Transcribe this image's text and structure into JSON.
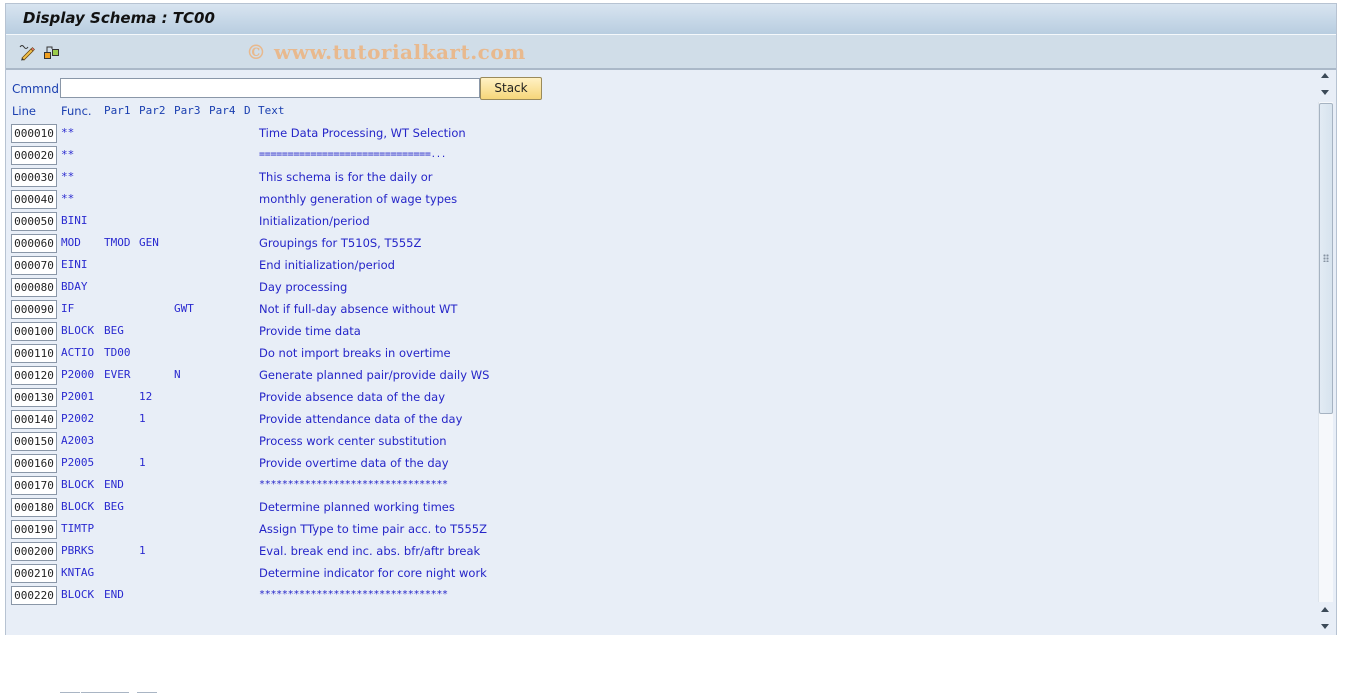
{
  "window": {
    "title": "Display Schema : TC00",
    "watermark": "© www.tutorialkart.com"
  },
  "toolbar": {
    "icons": [
      "display-change-icon",
      "other-object-icon"
    ]
  },
  "command": {
    "label": "Cmmnd",
    "value": "",
    "placeholder": "",
    "stack_button": "Stack"
  },
  "columns": {
    "line": "Line",
    "func": "Func.",
    "par1": "Par1",
    "par2": "Par2",
    "par3": "Par3",
    "par4": "Par4",
    "d": "D",
    "text": "Text"
  },
  "rows": [
    {
      "line": "000010",
      "func": "**",
      "par1": "",
      "par2": "",
      "par3": "",
      "par4": "",
      "d": "",
      "text": "Time Data Processing, WT Selection"
    },
    {
      "line": "000020",
      "func": "**",
      "par1": "",
      "par2": "",
      "par3": "",
      "par4": "",
      "d": "",
      "text": "==============================",
      "truncated": "..."
    },
    {
      "line": "000030",
      "func": "**",
      "par1": "",
      "par2": "",
      "par3": "",
      "par4": "",
      "d": "",
      "text": "This schema is for the daily or"
    },
    {
      "line": "000040",
      "func": "**",
      "par1": "",
      "par2": "",
      "par3": "",
      "par4": "",
      "d": "",
      "text": "monthly generation of wage types"
    },
    {
      "line": "000050",
      "func": "BINI",
      "par1": "",
      "par2": "",
      "par3": "",
      "par4": "",
      "d": "",
      "text": "Initialization/period"
    },
    {
      "line": "000060",
      "func": "MOD",
      "par1": "TMOD",
      "par2": "GEN",
      "par3": "",
      "par4": "",
      "d": "",
      "text": "Groupings for T510S, T555Z"
    },
    {
      "line": "000070",
      "func": "EINI",
      "par1": "",
      "par2": "",
      "par3": "",
      "par4": "",
      "d": "",
      "text": "End initialization/period"
    },
    {
      "line": "000080",
      "func": "BDAY",
      "par1": "",
      "par2": "",
      "par3": "",
      "par4": "",
      "d": "",
      "text": "Day processing"
    },
    {
      "line": "000090",
      "func": "IF",
      "par1": "",
      "par2": "",
      "par3": "GWT",
      "par4": "",
      "d": "",
      "text": "Not if full-day absence without WT"
    },
    {
      "line": "000100",
      "func": "BLOCK",
      "par1": "BEG",
      "par2": "",
      "par3": "",
      "par4": "",
      "d": "",
      "text": "Provide time data"
    },
    {
      "line": "000110",
      "func": "ACTIO",
      "par1": "TD00",
      "par2": "",
      "par3": "",
      "par4": "",
      "d": "",
      "text": "Do not import breaks in overtime"
    },
    {
      "line": "000120",
      "func": "P2000",
      "par1": "EVER",
      "par2": "",
      "par3": "N",
      "par4": "",
      "d": "",
      "text": "Generate planned pair/provide daily WS"
    },
    {
      "line": "000130",
      "func": "P2001",
      "par1": "",
      "par2": "12",
      "par3": "",
      "par4": "",
      "d": "",
      "text": "Provide absence data of the day"
    },
    {
      "line": "000140",
      "func": "P2002",
      "par1": "",
      "par2": "1",
      "par3": "",
      "par4": "",
      "d": "",
      "text": "Provide attendance data of the day"
    },
    {
      "line": "000150",
      "func": "A2003",
      "par1": "",
      "par2": "",
      "par3": "",
      "par4": "",
      "d": "",
      "text": "Process work center substitution"
    },
    {
      "line": "000160",
      "func": "P2005",
      "par1": "",
      "par2": "1",
      "par3": "",
      "par4": "",
      "d": "",
      "text": "Provide overtime data of the day"
    },
    {
      "line": "000170",
      "func": "BLOCK",
      "par1": "END",
      "par2": "",
      "par3": "",
      "par4": "",
      "d": "",
      "text": "*********************************"
    },
    {
      "line": "000180",
      "func": "BLOCK",
      "par1": "BEG",
      "par2": "",
      "par3": "",
      "par4": "",
      "d": "",
      "text": "Determine planned working times"
    },
    {
      "line": "000190",
      "func": "TIMTP",
      "par1": "",
      "par2": "",
      "par3": "",
      "par4": "",
      "d": "",
      "text": "Assign TType to time pair acc. to T555Z"
    },
    {
      "line": "000200",
      "func": "PBRKS",
      "par1": "",
      "par2": "1",
      "par3": "",
      "par4": "",
      "d": "",
      "text": "Eval. break end inc. abs. bfr/aftr break"
    },
    {
      "line": "000210",
      "func": "KNTAG",
      "par1": "",
      "par2": "",
      "par3": "",
      "par4": "",
      "d": "",
      "text": "Determine indicator for core night work"
    },
    {
      "line": "000220",
      "func": "BLOCK",
      "par1": "END",
      "par2": "",
      "par3": "",
      "par4": "",
      "d": "",
      "text": "*********************************"
    }
  ],
  "scrollbar": {
    "position_fraction": 0.0,
    "visible_fraction": 0.62
  }
}
